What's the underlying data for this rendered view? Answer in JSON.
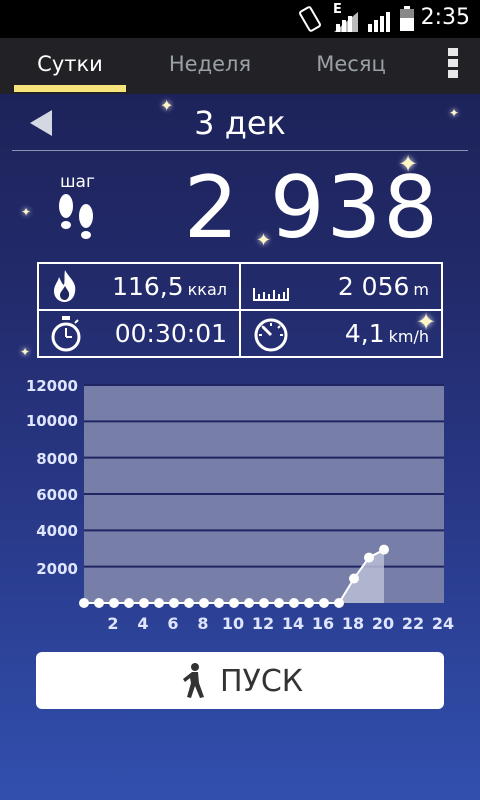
{
  "status_bar": {
    "time": "2:35",
    "network": "E",
    "icons": [
      "rotate-icon",
      "signal-icon",
      "signal-icon-2",
      "battery-icon"
    ]
  },
  "tabs": [
    {
      "label": "Сутки",
      "active": true
    },
    {
      "label": "Неделя",
      "active": false
    },
    {
      "label": "Месяц",
      "active": false
    }
  ],
  "menu_icon": "overflow-menu-icon",
  "date": {
    "label": "3 дек",
    "back_icon": "back-arrow-icon"
  },
  "steps": {
    "label": "шаг",
    "value": "2 938",
    "icon": "footprints-icon"
  },
  "stats": {
    "calories": {
      "value": "116,5",
      "unit": "ккал",
      "icon": "flame-icon"
    },
    "distance": {
      "value": "2 056",
      "unit": "m",
      "icon": "ruler-icon"
    },
    "duration": {
      "value": "00:30:01",
      "icon": "stopwatch-icon"
    },
    "speed": {
      "value": "4,1",
      "unit": "km/h",
      "icon": "speedometer-icon"
    }
  },
  "chart": {
    "y_ticks": [
      "12000",
      "10000",
      "8000",
      "6000",
      "4000",
      "2000"
    ],
    "x_ticks": [
      "2",
      "4",
      "6",
      "8",
      "10",
      "12",
      "14",
      "16",
      "18",
      "20",
      "22",
      "24"
    ],
    "ylim": [
      0,
      12000
    ],
    "xlim": [
      0,
      24
    ],
    "points": [
      [
        0,
        0
      ],
      [
        1,
        0
      ],
      [
        2,
        0
      ],
      [
        3,
        0
      ],
      [
        4,
        0
      ],
      [
        5,
        0
      ],
      [
        6,
        0
      ],
      [
        7,
        0
      ],
      [
        8,
        0
      ],
      [
        9,
        0
      ],
      [
        10,
        0
      ],
      [
        11,
        0
      ],
      [
        12,
        0
      ],
      [
        13,
        0
      ],
      [
        14,
        0
      ],
      [
        15,
        0
      ],
      [
        16,
        0
      ],
      [
        17,
        0
      ],
      [
        18,
        1350
      ],
      [
        19,
        2500
      ],
      [
        20,
        2938
      ]
    ],
    "colors": {
      "plot_bg": "#777ea8",
      "grid": "#1e2560",
      "line": "#ffffff",
      "fill": "#b8bdd6"
    }
  },
  "start_button": {
    "label": "ПУСК",
    "icon": "walking-person-icon"
  }
}
